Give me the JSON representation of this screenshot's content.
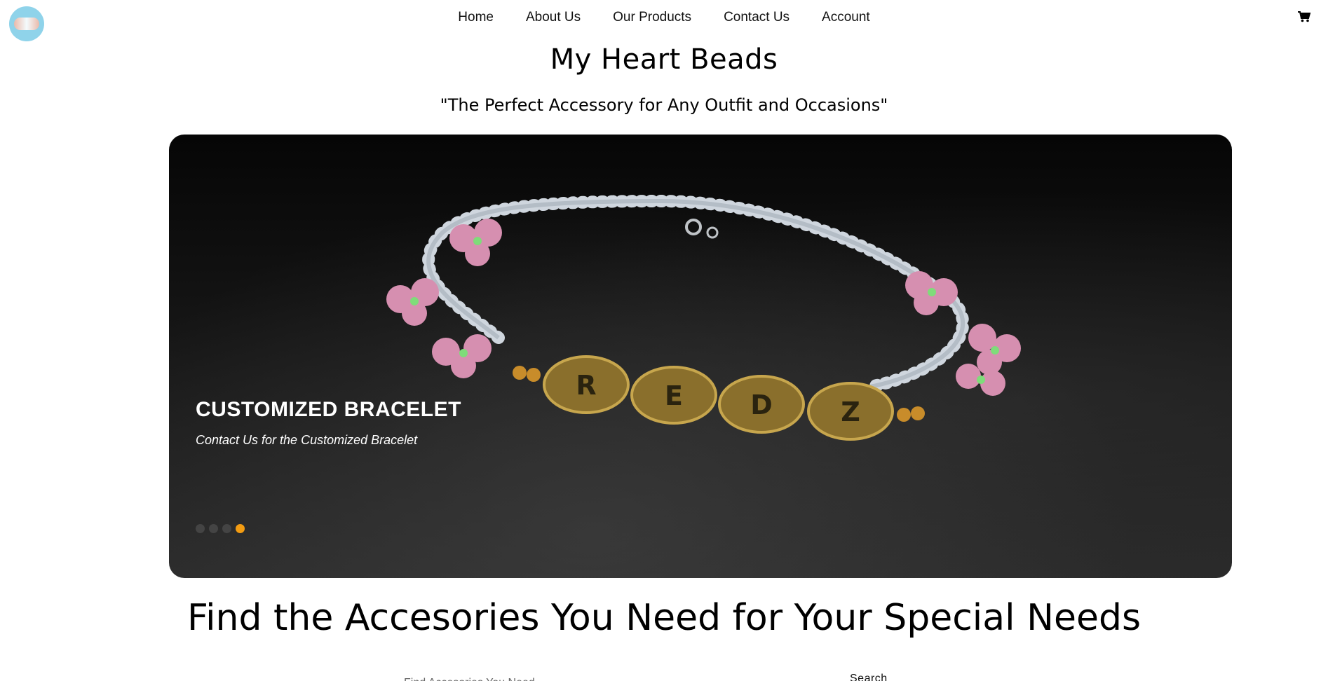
{
  "header": {
    "nav": [
      "Home",
      "About Us",
      "Our Products",
      "Contact Us",
      "Account"
    ],
    "cart_icon": "shopping-cart-icon",
    "logo_icon": "brand-logo"
  },
  "site": {
    "title": "My Heart Beads",
    "tagline": "\"The Perfect Accessory for Any Outfit and Occasions\""
  },
  "carousel": {
    "slide_title": "CUSTOMIZED BRACELET",
    "slide_subtitle": "Contact Us for the Customized Bracelet",
    "bead_letters": [
      "R",
      "E",
      "D",
      "Z"
    ],
    "slide_count": 4,
    "active_slide": 4,
    "active_color": "#f39c12"
  },
  "search": {
    "heading": "Find the Accesories You Need for Your Special Needs",
    "placeholder": "Find Accesories You Need",
    "button_label": "Search"
  }
}
